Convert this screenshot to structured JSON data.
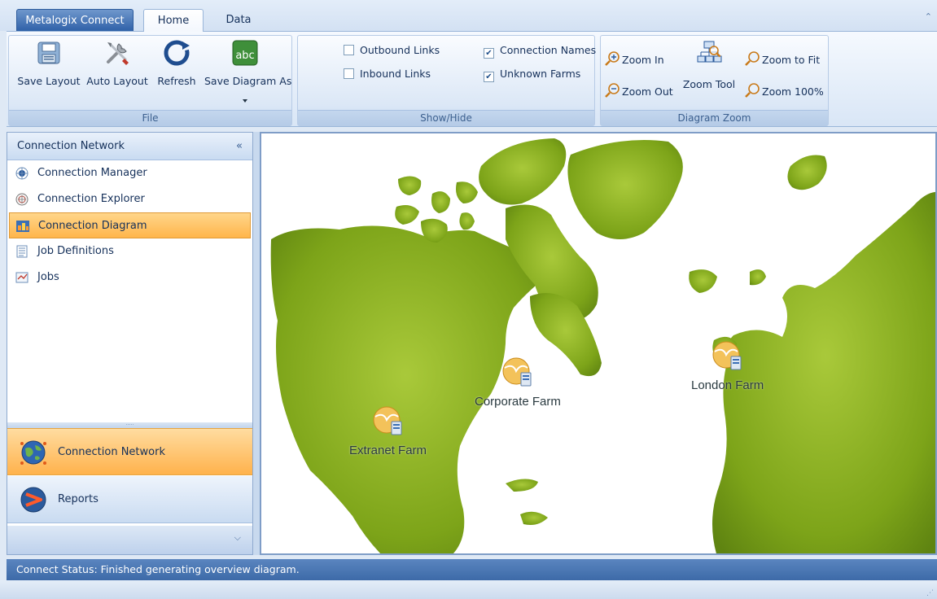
{
  "app": {
    "app_tab": "Metalogix Connect",
    "tabs": [
      "Home",
      "Data"
    ]
  },
  "ribbon": {
    "file_group": {
      "label": "File",
      "buttons": [
        "Save Layout",
        "Auto Layout",
        "Refresh",
        "Save Diagram As"
      ]
    },
    "showhide_group": {
      "label": "Show/Hide",
      "checkboxes": [
        {
          "label": "Outbound Links",
          "checked": false
        },
        {
          "label": "Inbound Links",
          "checked": false
        },
        {
          "label": "Connection Names",
          "checked": true
        },
        {
          "label": "Unknown Farms",
          "checked": true
        }
      ]
    },
    "zoom_group": {
      "label": "Diagram Zoom",
      "zoom_in": "Zoom In",
      "zoom_out": "Zoom Out",
      "zoom_tool": "Zoom Tool",
      "zoom_fit": "Zoom to Fit",
      "zoom_100": "Zoom 100%"
    }
  },
  "left_pane": {
    "header": "Connection Network",
    "items": [
      "Connection Manager",
      "Connection Explorer",
      "Connection Diagram",
      "Job Definitions",
      "Jobs"
    ],
    "selected_item": "Connection Diagram",
    "big_nav": [
      "Connection Network",
      "Reports"
    ]
  },
  "diagram": {
    "farms": [
      "Corporate Farm",
      "Extranet Farm",
      "London Farm"
    ],
    "map_color": "#7fa81d"
  },
  "status": {
    "text": "Connect Status:  Finished generating overview diagram."
  }
}
